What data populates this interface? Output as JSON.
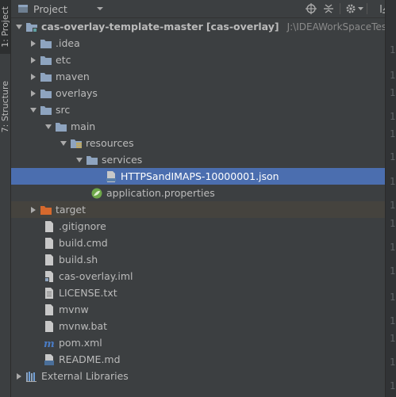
{
  "toolstrip": {
    "project_tab": "1: Project",
    "structure_tab": "7: Structure"
  },
  "header": {
    "title": "Project",
    "buttons": [
      "locate-icon",
      "collapse-all-icon",
      "gear-icon",
      "hide-icon"
    ]
  },
  "tree": {
    "root_name": "cas-overlay-template-master",
    "root_module": "[cas-overlay]",
    "root_path": "J:\\IDEAWorkSpaceTest\\cas-ov",
    "idea": ".idea",
    "etc": "etc",
    "maven": "maven",
    "overlays": "overlays",
    "src": "src",
    "main": "main",
    "resources": "resources",
    "services": "services",
    "json_file": "HTTPSandIMAPS-10000001.json",
    "app_props": "application.properties",
    "target": "target",
    "gitignore": ".gitignore",
    "build_cmd": "build.cmd",
    "build_sh": "build.sh",
    "iml": "cas-overlay.iml",
    "license": "LICENSE.txt",
    "mvnw": "mvnw",
    "mvnw_bat": "mvnw.bat",
    "pom": "pom.xml",
    "readme": "README.md",
    "external_libraries": "External Libraries"
  },
  "gutter_digit": "1",
  "colors": {
    "background": "#3c3f41",
    "selection": "#4b6eaf",
    "folder": "#8ea4bf",
    "excluded_folder": "#d6692d"
  }
}
